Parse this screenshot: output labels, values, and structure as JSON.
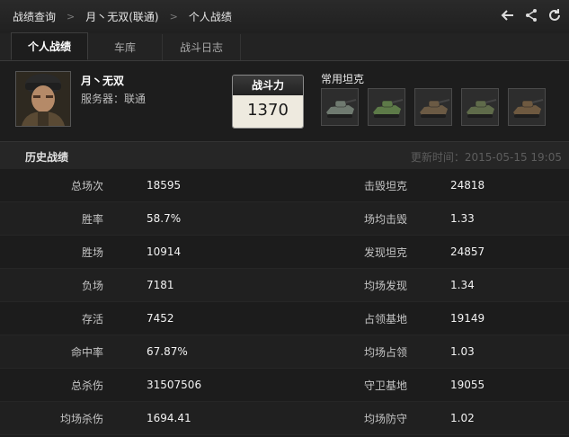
{
  "breadcrumb": {
    "items": [
      "战绩查询",
      "月丶无双(联通)",
      "个人战绩"
    ],
    "separator": ">"
  },
  "top_actions": [
    {
      "icon": "back-arrow-icon"
    },
    {
      "icon": "share-icon"
    },
    {
      "icon": "refresh-icon"
    }
  ],
  "tabs": [
    {
      "label": "个人战绩",
      "active": true
    },
    {
      "label": "车库",
      "active": false
    },
    {
      "label": "战斗日志",
      "active": false
    }
  ],
  "profile": {
    "name": "月丶无双",
    "server": "服务器：联通"
  },
  "power": {
    "label": "战斗力",
    "value": "1370"
  },
  "tanks": {
    "title": "常用坦克",
    "items": [
      {
        "icon": "tank-icon",
        "color": "#6f7a70"
      },
      {
        "icon": "tank-icon",
        "color": "#5d7a48"
      },
      {
        "icon": "tank-icon",
        "color": "#6b5a44"
      },
      {
        "icon": "tank-icon",
        "color": "#5f6b4a"
      },
      {
        "icon": "tank-icon",
        "color": "#6e5940"
      }
    ]
  },
  "history": {
    "title": "历史战绩",
    "update_time": "更新时间：2015-05-15 19:05",
    "rows": [
      {
        "label": "总场次",
        "value": "18595",
        "label2": "击毁坦克",
        "value2": "24818"
      },
      {
        "label": "胜率",
        "value": "58.7%",
        "label2": "场均击毁",
        "value2": "1.33"
      },
      {
        "label": "胜场",
        "value": "10914",
        "label2": "发现坦克",
        "value2": "24857"
      },
      {
        "label": "负场",
        "value": "7181",
        "label2": "均场发现",
        "value2": "1.34"
      },
      {
        "label": "存活",
        "value": "7452",
        "label2": "占领基地",
        "value2": "19149"
      },
      {
        "label": "命中率",
        "value": "67.87%",
        "label2": "均场占领",
        "value2": "1.03"
      },
      {
        "label": "总杀伤",
        "value": "31507506",
        "label2": "守卫基地",
        "value2": "19055"
      },
      {
        "label": "均场杀伤",
        "value": "1694.41",
        "label2": "均场防守",
        "value2": "1.02"
      }
    ]
  }
}
